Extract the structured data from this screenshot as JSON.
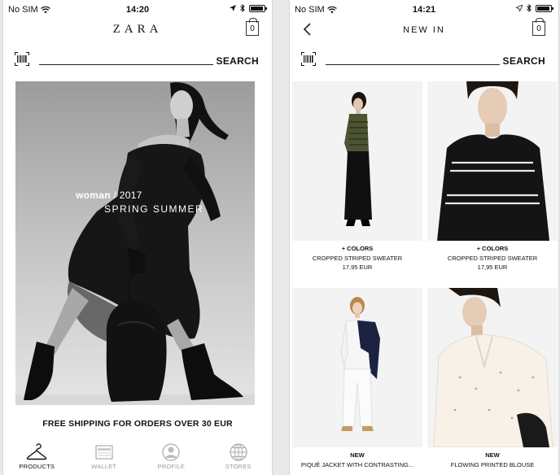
{
  "left": {
    "status": {
      "carrier": "No SIM",
      "time": "14:20"
    },
    "logo": "ZARA",
    "bag_count": "0",
    "search_label": "SEARCH",
    "hero": {
      "line1_bold": "woman",
      "line1_rest": " / 2017",
      "line2": "SPRING SUMMER"
    },
    "shipping": "FREE SHIPPING FOR ORDERS OVER 30 EUR",
    "tabs": [
      {
        "label": "PRODUCTS",
        "icon": "hanger-icon",
        "active": true
      },
      {
        "label": "WALLET",
        "icon": "wallet-icon",
        "active": false
      },
      {
        "label": "PROFILE",
        "icon": "profile-icon",
        "active": false
      },
      {
        "label": "STORES",
        "icon": "globe-icon",
        "active": false
      }
    ]
  },
  "right": {
    "status": {
      "carrier": "No SIM",
      "time": "14:21"
    },
    "title": "NEW IN",
    "bag_count": "0",
    "search_label": "SEARCH",
    "products": [
      {
        "tag": "+ COLORS",
        "name": "CROPPED STRIPED SWEATER",
        "price": "17,95 EUR"
      },
      {
        "tag": "+ COLORS",
        "name": "CROPPED STRIPED SWEATER",
        "price": "17,95 EUR"
      },
      {
        "tag": "NEW",
        "name": "PIQUÉ JACKET WITH CONTRASTING...",
        "price": ""
      },
      {
        "tag": "NEW",
        "name": "FLOWING PRINTED BLOUSE",
        "price": ""
      }
    ]
  },
  "colors": {
    "active": "#111111",
    "inactive": "#999999",
    "accent_navy": "#1b2340"
  }
}
